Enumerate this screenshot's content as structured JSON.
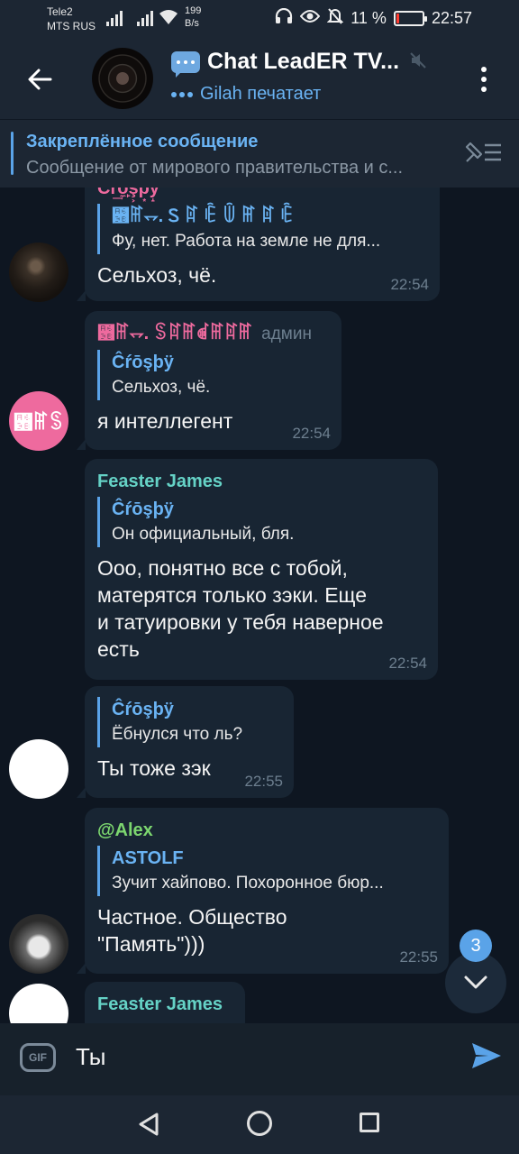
{
  "status_bar": {
    "carrier1": "Tele2",
    "carrier2": "MTS RUS",
    "speed_value": "199",
    "speed_unit": "B/s",
    "battery_percent": "11 %",
    "battery_level": 0.11,
    "time": "22:57"
  },
  "header": {
    "title": "Chat LeadER TV...",
    "status": "Gilah печатает",
    "icons": [
      "back-arrow-icon",
      "speech-bubble-icon",
      "mute-icon",
      "more-vert-icon"
    ]
  },
  "pinned": {
    "title": "Закреплённое сообщение",
    "text": "Сообщение от мирового правительства и с..."
  },
  "messages": [
    {
      "sender": "Ĉŕ͢ō̼̙ş͕þ͙ÿ̝",
      "reply_name": "꘻ꂵ⥐. Ꮪ ꍏ ꍟ ꅏ ꂵ ꍏ ꍟ",
      "reply_text": "Фу, нет. Работа на земле не для...",
      "text": "Сельхоз, чё.",
      "time": "22:54"
    },
    {
      "sender": "꘻ꂵ⥐. ꌗꍏꂵꀷꂵꍏꂵ",
      "badge": "админ",
      "reply_name": "Ĉŕōşþÿ",
      "reply_text": "Сельхоз, чё.",
      "text": "я интеллегент",
      "time": "22:54",
      "avatar_text": "꘻ꂵꌗ"
    },
    {
      "sender": "Feaster James",
      "reply_name": "Ĉŕōşþÿ",
      "reply_text": "Он официальный, бля.",
      "text_lines": [
        "Ооо, понятно все с тобой,",
        "матерятся только зэки. Еще",
        "и татуировки у тебя наверное",
        "есть"
      ],
      "time": "22:54"
    },
    {
      "reply_name": "Ĉŕōşþÿ",
      "reply_text": "Ёбнулся что ль?",
      "text": "Ты тоже зэк",
      "time": "22:55"
    },
    {
      "sender": "@Alex",
      "reply_name": "ASTOLF",
      "reply_text": "Зучит хайпово. Похоронное бюр...",
      "text_lines": [
        "Частное. Общество",
        "\"Память\")))"
      ],
      "time": "22:55"
    },
    {
      "sender": "Feaster James"
    }
  ],
  "jump": {
    "count": "3"
  },
  "composer": {
    "input_value": "Ты"
  },
  "colors": {
    "background": "#0e1621",
    "bubble": "#182533",
    "accent": "#6ab3f3",
    "sender_pink": "#ee6a9e",
    "sender_teal": "#65d2c6",
    "sender_green": "#7cd66f"
  }
}
